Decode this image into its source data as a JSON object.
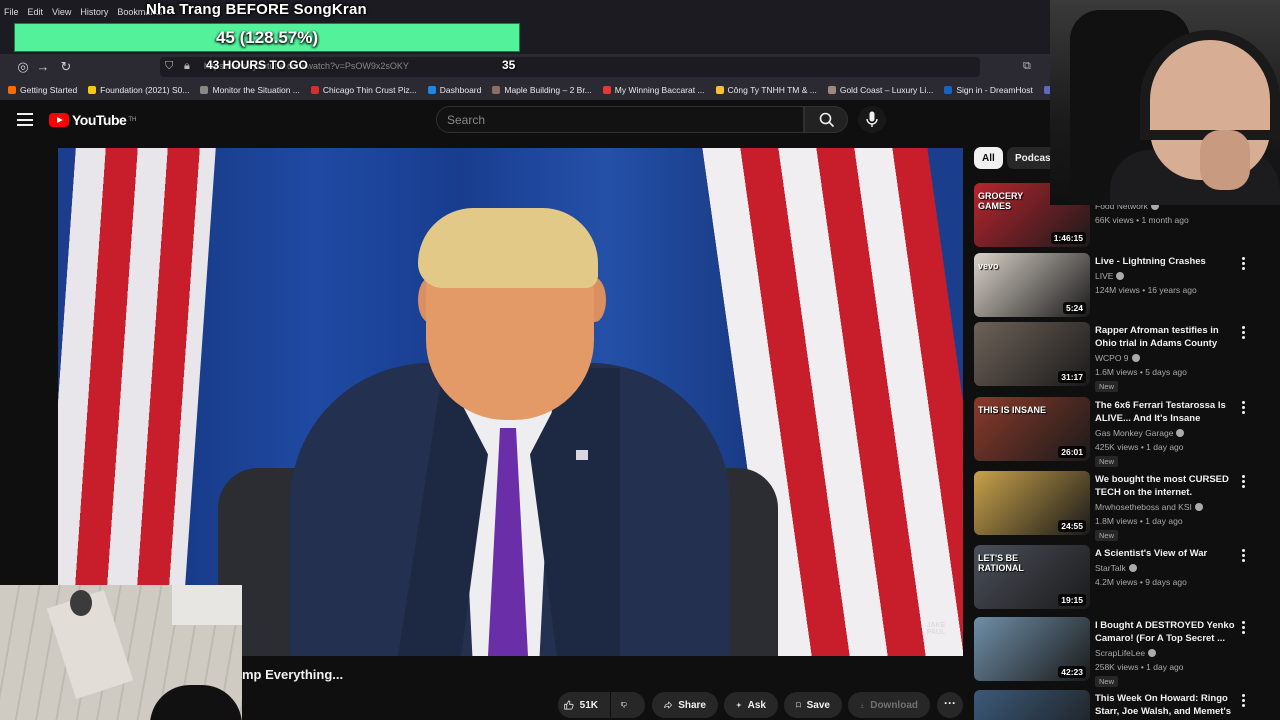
{
  "browser": {
    "menu": [
      "File",
      "Edit",
      "View",
      "History",
      "Bookmarks"
    ],
    "url": "https://www.youtube.com/watch?v=PsOW9x2sOKY",
    "bookmarks": [
      {
        "label": "Getting Started",
        "color": "#ff6a00"
      },
      {
        "label": "Foundation (2021) S0...",
        "color": "#f5c518"
      },
      {
        "label": "Monitor the Situation ...",
        "color": "#888888"
      },
      {
        "label": "Chicago Thin Crust Piz...",
        "color": "#d32f2f"
      },
      {
        "label": "Dashboard",
        "color": "#1e88e5"
      },
      {
        "label": "Maple Building – 2 Br...",
        "color": "#8d6e63"
      },
      {
        "label": "My Winning Baccarat ...",
        "color": "#e53935"
      },
      {
        "label": "Công Ty TNHH TM & ...",
        "color": "#fbc02d"
      },
      {
        "label": "Gold Coast – Luxury Li...",
        "color": "#a1887f"
      },
      {
        "label": "Sign in - DreamHost",
        "color": "#1565c0"
      },
      {
        "label": "(2) New Messa",
        "color": "#5c6bc0"
      }
    ]
  },
  "overlay": {
    "stream_title": "Nha Trang BEFORE SongKran",
    "goal_text": "45 (128.57%)",
    "goal_fraction": 1.0,
    "countdown": "43 HOURS TO GO",
    "counter": "35"
  },
  "youtube": {
    "logo_text": "YouTube",
    "logo_sup": "TH",
    "search_placeholder": "Search",
    "video_title": "mp Everything...",
    "watermark": "JAKE PAUL",
    "actions": {
      "like_count": "51K",
      "share": "Share",
      "ask": "Ask",
      "save": "Save",
      "download": "Download"
    },
    "chips": [
      "All",
      "Podcasts"
    ],
    "recommendations": [
      {
        "title": "Grocery Games",
        "channel": "Food Network",
        "meta": "66K views • 1 month ago",
        "duration": "1:46:15",
        "thumb_text": "GROCERY GAMES",
        "thumb_color": "#b8242e",
        "badge": ""
      },
      {
        "title": "Live - Lightning Crashes",
        "channel": "LIVE",
        "meta": "124M views • 16 years ago",
        "duration": "5:24",
        "thumb_text": "vevo",
        "thumb_color": "#d9d2c8",
        "badge": ""
      },
      {
        "title": "Rapper Afroman testifies in Ohio trial in Adams County",
        "channel": "WCPO 9",
        "meta": "1.6M views • 5 days ago",
        "duration": "31:17",
        "thumb_text": "",
        "thumb_color": "#6e6258",
        "badge": "New"
      },
      {
        "title": "The 6x6 Ferrari Testarossa Is ALIVE... And It's Insane",
        "channel": "Gas Monkey Garage",
        "meta": "425K views • 1 day ago",
        "duration": "26:01",
        "thumb_text": "THIS IS INSANE",
        "thumb_color": "#8a3a2a",
        "badge": "New"
      },
      {
        "title": "We bought the most CURSED TECH on the internet.",
        "channel": "Mrwhosetheboss and KSI",
        "meta": "1.8M views • 1 day ago",
        "duration": "24:55",
        "thumb_text": "",
        "thumb_color": "#c9a24a",
        "badge": "New"
      },
      {
        "title": "A Scientist's View of War",
        "channel": "StarTalk",
        "meta": "4.2M views • 9 days ago",
        "duration": "19:15",
        "thumb_text": "LET'S BE RATIONAL",
        "thumb_color": "#4a4f5a",
        "badge": ""
      },
      {
        "title": "I Bought A DESTROYED Yenko Camaro! (For A Top Secret ...",
        "channel": "ScrapLifeLee",
        "meta": "258K views • 1 day ago",
        "duration": "42:23",
        "thumb_text": "",
        "thumb_color": "#6f8fa8",
        "badge": "New"
      },
      {
        "title": "This Week On Howard: Ringo Starr, Joe Walsh, and Memet's ...",
        "channel": "",
        "meta": "",
        "duration": "",
        "thumb_text": "",
        "thumb_color": "#3c5a7a",
        "badge": ""
      }
    ]
  },
  "colors": {
    "yt_red": "#ff0000",
    "goal_green": "#52f19a",
    "tie_purple": "#6a2ea8"
  }
}
